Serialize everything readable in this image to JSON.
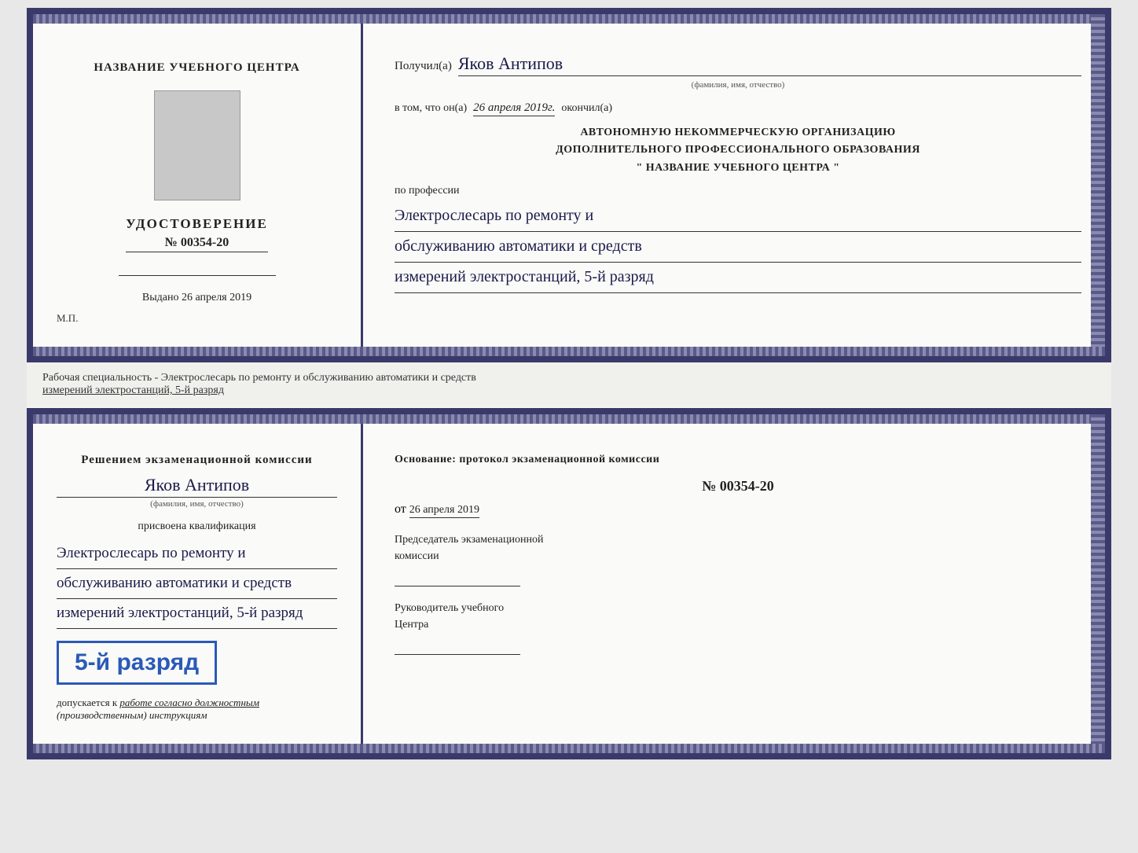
{
  "top_diploma": {
    "left": {
      "center_title": "НАЗВАНИЕ УЧЕБНОГО ЦЕНТРА",
      "udostoverenie_label": "УДОСТОВЕРЕНИЕ",
      "number": "№ 00354-20",
      "issued_label": "Выдано",
      "issued_date": "26 апреля 2019",
      "mp_label": "М.П."
    },
    "right": {
      "recipient_label": "Получил(а)",
      "recipient_name": "Яков Антипов",
      "fio_subtitle": "(фамилия, имя, отчество)",
      "vtom_label": "в том, что он(а)",
      "vtom_date": "26 апреля 2019г.",
      "okончил_label": "окончил(а)",
      "org_line1": "АВТОНОМНУЮ НЕКОММЕРЧЕСКУЮ ОРГАНИЗАЦИЮ",
      "org_line2": "ДОПОЛНИТЕЛЬНОГО ПРОФЕССИОНАЛЬНОГО ОБРАЗОВАНИЯ",
      "org_line3": "\"  НАЗВАНИЕ УЧЕБНОГО ЦЕНТРА  \"",
      "po_professii": "по профессии",
      "profession_line1": "Электрослесарь по ремонту и",
      "profession_line2": "обслуживанию автоматики и средств",
      "profession_line3": "измерений электростанций, 5-й разряд"
    }
  },
  "middle": {
    "text": "Рабочая специальность - Электрослесарь по ремонту и обслуживанию автоматики и средств",
    "text2": "измерений электростанций, 5-й разряд"
  },
  "bottom_diploma": {
    "left": {
      "resheniem": "Решением экзаменационной комиссии",
      "name": "Яков Антипов",
      "fio_subtitle": "(фамилия, имя, отчество)",
      "prisvoena": "присвоена квалификация",
      "qual_line1": "Электрослесарь по ремонту и",
      "qual_line2": "обслуживанию автоматики и средств",
      "qual_line3": "измерений электростанций, 5-й разряд",
      "razryad_badge": "5-й разряд",
      "dopuskaetsya": "допускается к",
      "dopuskaetsya_text": "работе согласно должностным",
      "dopuskaetsya_text2": "(производственным) инструкциям"
    },
    "right": {
      "osnovanie": "Основание: протокол экзаменационной комиссии",
      "number": "№ 00354-20",
      "ot_label": "от",
      "ot_date": "26 апреля 2019",
      "chairman_title1": "Председатель экзаменационной",
      "chairman_title2": "комиссии",
      "rukovoditel_title1": "Руководитель учебного",
      "rukovoditel_title2": "Центра"
    }
  }
}
